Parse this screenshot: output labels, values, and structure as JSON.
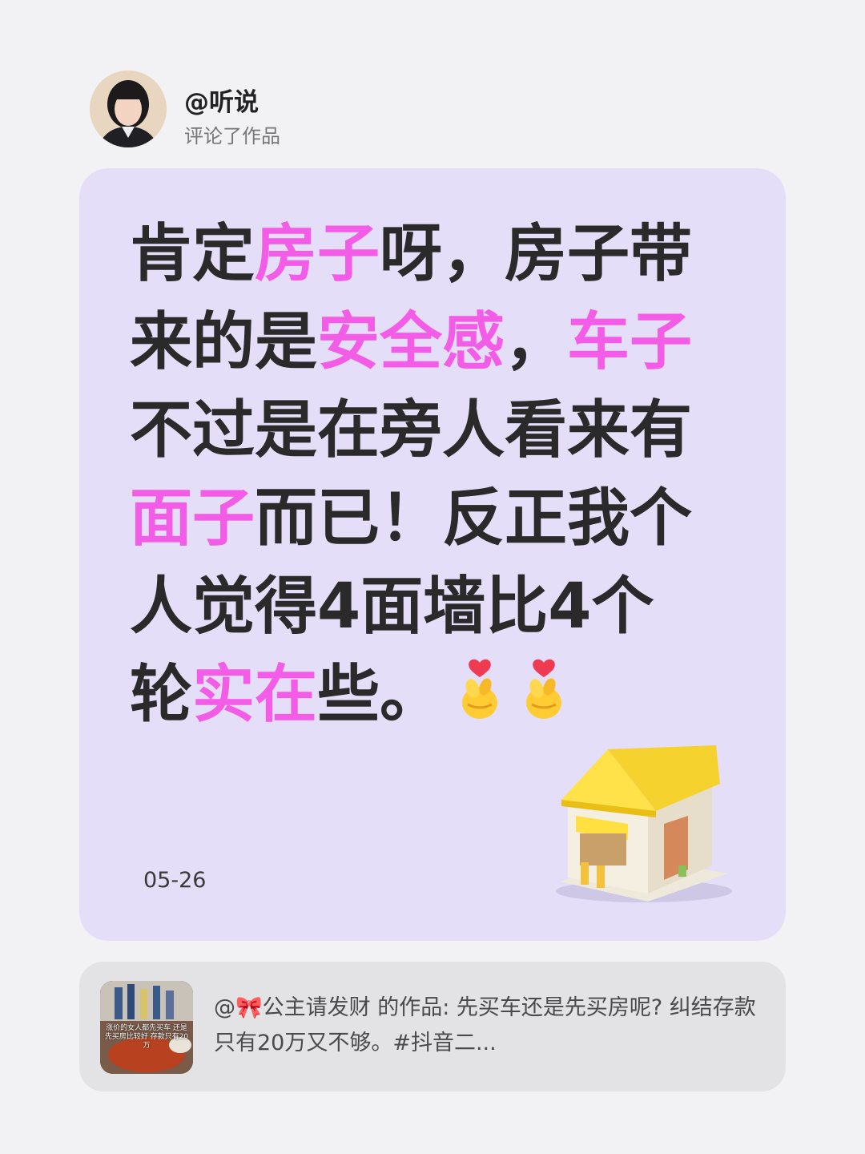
{
  "header": {
    "username": "@听说",
    "action": "评论了作品"
  },
  "comment": {
    "segments": [
      {
        "text": "肯定",
        "hl": false
      },
      {
        "text": "房子",
        "hl": true
      },
      {
        "text": "呀，房子带来的是",
        "hl": false
      },
      {
        "text": "安全感",
        "hl": true
      },
      {
        "text": "，",
        "hl": false
      },
      {
        "text": "车子",
        "hl": true
      },
      {
        "text": "不过是在旁人看来有",
        "hl": false
      },
      {
        "text": "面子",
        "hl": true
      },
      {
        "text": "而已！反正我个人觉得4面墙比4个轮",
        "hl": false
      },
      {
        "text": "实在",
        "hl": true
      },
      {
        "text": "些。",
        "hl": false
      }
    ],
    "emoji_icons": [
      "finger-heart-icon",
      "finger-heart-icon"
    ],
    "date": "05-26"
  },
  "reference": {
    "text": "@🎀公主请发财 的作品: 先买车还是先买房呢? 纠结存款只有20万又不够。#抖音二...",
    "thumb_caption": "涨价的女人都先买车 还是先买房比较好 存款只有20万"
  },
  "colors": {
    "background": "#f2f1f3",
    "card": "#e5def9",
    "highlight": "#f25ce7",
    "text": "#2a2a2a",
    "reference_card": "#e3e2e4"
  }
}
